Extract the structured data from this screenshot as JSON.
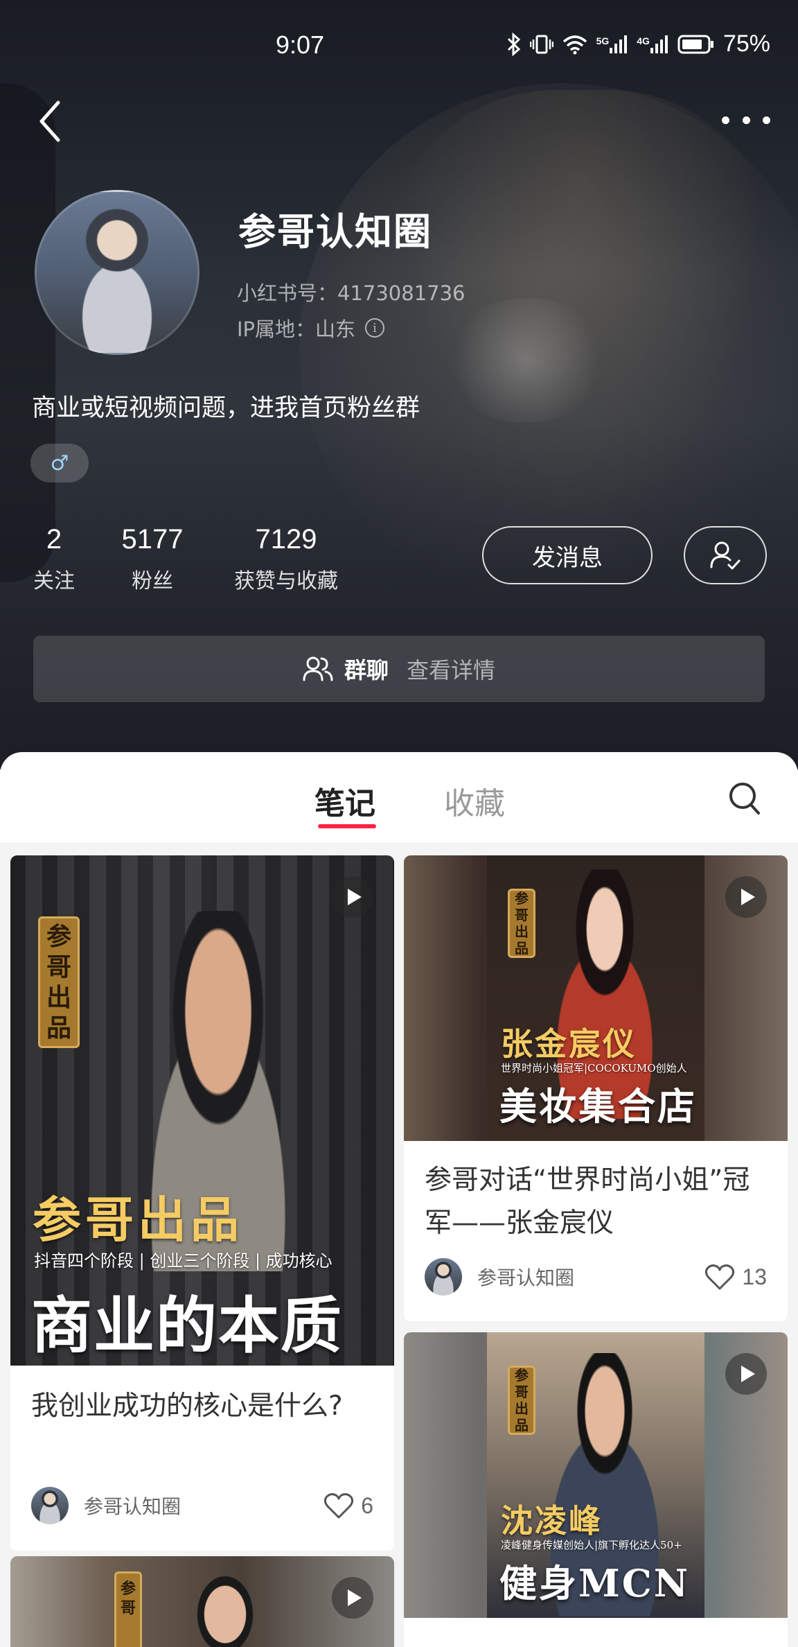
{
  "status_bar": {
    "time": "9:07",
    "battery": "75%",
    "net1": "5G",
    "net2": "4G"
  },
  "profile": {
    "nickname": "参哥认知圈",
    "red_id": "小红书号：4173081736",
    "ip_location": "IP属地：山东",
    "info_icon_glyph": "i",
    "bio": "商业或短视频问题，进我首页粉丝群",
    "gender_icon": "♂",
    "stats": [
      {
        "num": "2",
        "label": "关注"
      },
      {
        "num": "5177",
        "label": "粉丝"
      },
      {
        "num": "7129",
        "label": "获赞与收藏"
      }
    ],
    "message_button": "发消息",
    "group_chat": {
      "label": "群聊",
      "sub": "查看详情"
    }
  },
  "tabs": {
    "notes": "笔记",
    "favorites": "收藏"
  },
  "notes": [
    {
      "cover": {
        "seal_text": [
          "参",
          "哥",
          "出",
          "品"
        ],
        "gold_title": "参哥出品",
        "sub_line": "抖音四个阶段 | 创业三个阶段 | 成功核心",
        "big_title": "商业的本质"
      },
      "title": "我创业成功的核心是什么?",
      "author": "参哥认知圈",
      "likes": "6"
    },
    {
      "cover": {
        "seal_text": [
          "参",
          "哥",
          "出",
          "品"
        ],
        "gold_title": "张金宸仪",
        "sub_line": "世界时尚小姐冠军|COCOKUMO创始人",
        "big_title": "美妆集合店"
      },
      "title": "参哥对话“世界时尚小姐”冠军——张金宸仪",
      "author": "参哥认知圈",
      "likes": "13"
    },
    {
      "cover": {
        "seal_text": [
          "参",
          "哥",
          "出",
          "品"
        ],
        "gold_title": "沈凌峰",
        "sub_line": "凌峰健身传媒创始人|旗下孵化达人50+",
        "big_title": "健身MCN"
      }
    },
    {
      "cover": {
        "seal_text": [
          "参",
          "哥"
        ]
      }
    }
  ],
  "colors": {
    "accent": "#ff2442",
    "gold": "#f5cc63",
    "header_bg": "#2b3038"
  },
  "icons": [
    "back-arrow-icon",
    "more-dots-icon",
    "info-icon",
    "male-icon",
    "add-friend-icon",
    "group-chat-icon",
    "search-icon",
    "play-icon",
    "heart-icon"
  ]
}
